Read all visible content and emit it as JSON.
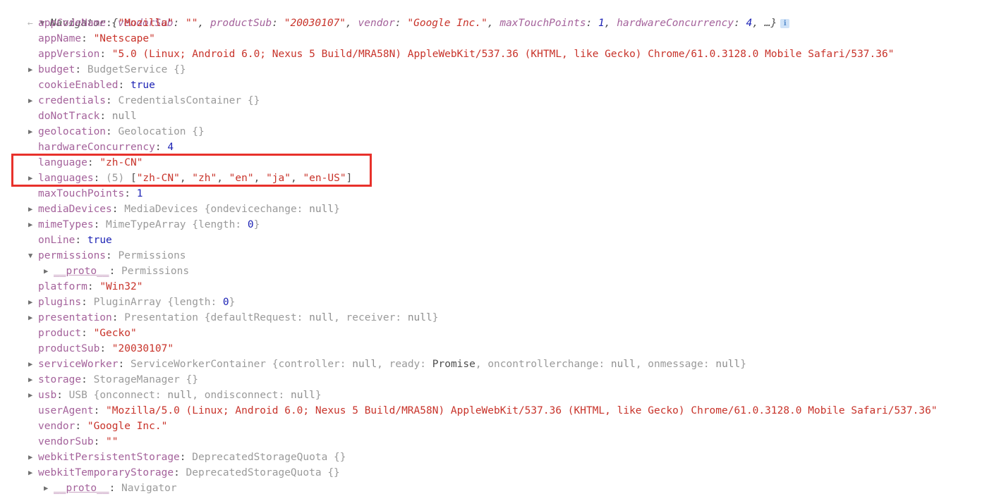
{
  "console": {
    "result_arrow": "←",
    "info_badge_label": "i",
    "header": {
      "expander": "▼",
      "class_name": "Navigator",
      "open_brace": " {",
      "preview": [
        {
          "key": "vendorSub",
          "sep": ": ",
          "value": "\"\"",
          "type": "string"
        },
        {
          "key": "productSub",
          "sep": ": ",
          "value": "\"20030107\"",
          "type": "string"
        },
        {
          "key": "vendor",
          "sep": ": ",
          "value": "\"Google Inc.\"",
          "type": "string"
        },
        {
          "key": "maxTouchPoints",
          "sep": ": ",
          "value": "1",
          "type": "number"
        },
        {
          "key": "hardwareConcurrency",
          "sep": ": ",
          "value": "4",
          "type": "number"
        }
      ],
      "ellipsis": ", …}"
    },
    "rows": [
      {
        "tri": "",
        "indent": 1,
        "prop": "appCodeName",
        "value": "\"Mozilla\"",
        "vtype": "string"
      },
      {
        "tri": "",
        "indent": 1,
        "prop": "appName",
        "value": "\"Netscape\"",
        "vtype": "string"
      },
      {
        "tri": "",
        "indent": 1,
        "prop": "appVersion",
        "value": "\"5.0 (Linux; Android 6.0; Nexus 5 Build/MRA58N) AppleWebKit/537.36 (KHTML, like Gecko) Chrome/61.0.3128.0 Mobile Safari/537.36\"",
        "vtype": "string"
      },
      {
        "tri": "▶",
        "indent": 1,
        "prop": "budget",
        "value": "BudgetService {}",
        "vtype": "class"
      },
      {
        "tri": "",
        "indent": 1,
        "prop": "cookieEnabled",
        "value": "true",
        "vtype": "bool"
      },
      {
        "tri": "▶",
        "indent": 1,
        "prop": "credentials",
        "value": "CredentialsContainer {}",
        "vtype": "class"
      },
      {
        "tri": "",
        "indent": 1,
        "prop": "doNotTrack",
        "value": "null",
        "vtype": "null"
      },
      {
        "tri": "▶",
        "indent": 1,
        "prop": "geolocation",
        "value": "Geolocation {}",
        "vtype": "class"
      },
      {
        "tri": "",
        "indent": 1,
        "prop": "hardwareConcurrency",
        "value": "4",
        "vtype": "number"
      },
      {
        "tri": "",
        "indent": 1,
        "prop": "language",
        "value": "\"zh-CN\"",
        "vtype": "string"
      },
      {
        "tri": "▶",
        "indent": 1,
        "prop": "languages",
        "value": "(5) [\"zh-CN\", \"zh\", \"en\", \"ja\", \"en-US\"]",
        "vtype": "array"
      },
      {
        "tri": "",
        "indent": 1,
        "prop": "maxTouchPoints",
        "value": "1",
        "vtype": "number"
      },
      {
        "tri": "▶",
        "indent": 1,
        "prop": "mediaDevices",
        "value": "MediaDevices {ondevicechange: null}",
        "vtype": "class"
      },
      {
        "tri": "▶",
        "indent": 1,
        "prop": "mimeTypes",
        "value": "MimeTypeArray {length: 0}",
        "vtype": "class"
      },
      {
        "tri": "",
        "indent": 1,
        "prop": "onLine",
        "value": "true",
        "vtype": "bool"
      },
      {
        "tri": "▼",
        "indent": 1,
        "prop": "permissions",
        "value": "Permissions",
        "vtype": "class"
      },
      {
        "tri": "▶",
        "indent": 2,
        "prop": "__proto__",
        "value": "Permissions",
        "vtype": "class",
        "is_proto": true
      },
      {
        "tri": "",
        "indent": 1,
        "prop": "platform",
        "value": "\"Win32\"",
        "vtype": "string"
      },
      {
        "tri": "▶",
        "indent": 1,
        "prop": "plugins",
        "value": "PluginArray {length: 0}",
        "vtype": "class"
      },
      {
        "tri": "▶",
        "indent": 1,
        "prop": "presentation",
        "value": "Presentation {defaultRequest: null, receiver: null}",
        "vtype": "class"
      },
      {
        "tri": "",
        "indent": 1,
        "prop": "product",
        "value": "\"Gecko\"",
        "vtype": "string"
      },
      {
        "tri": "",
        "indent": 1,
        "prop": "productSub",
        "value": "\"20030107\"",
        "vtype": "string"
      },
      {
        "tri": "▶",
        "indent": 1,
        "prop": "serviceWorker",
        "value": "ServiceWorkerContainer {controller: null, ready: Promise, oncontrollerchange: null, onmessage: null}",
        "vtype": "class"
      },
      {
        "tri": "▶",
        "indent": 1,
        "prop": "storage",
        "value": "StorageManager {}",
        "vtype": "class"
      },
      {
        "tri": "▶",
        "indent": 1,
        "prop": "usb",
        "value": "USB {onconnect: null, ondisconnect: null}",
        "vtype": "class"
      },
      {
        "tri": "",
        "indent": 1,
        "prop": "userAgent",
        "value": "\"Mozilla/5.0 (Linux; Android 6.0; Nexus 5 Build/MRA58N) AppleWebKit/537.36 (KHTML, like Gecko) Chrome/61.0.3128.0 Mobile Safari/537.36\"",
        "vtype": "string"
      },
      {
        "tri": "",
        "indent": 1,
        "prop": "vendor",
        "value": "\"Google Inc.\"",
        "vtype": "string"
      },
      {
        "tri": "",
        "indent": 1,
        "prop": "vendorSub",
        "value": "\"\"",
        "vtype": "string"
      },
      {
        "tri": "▶",
        "indent": 1,
        "prop": "webkitPersistentStorage",
        "value": "DeprecatedStorageQuota {}",
        "vtype": "class"
      },
      {
        "tri": "▶",
        "indent": 1,
        "prop": "webkitTemporaryStorage",
        "value": "DeprecatedStorageQuota {}",
        "vtype": "class"
      },
      {
        "tri": "▶",
        "indent": 2,
        "prop": "__proto__",
        "value": "Navigator",
        "vtype": "class",
        "is_proto": true
      }
    ]
  },
  "annotation": {
    "highlight_color": "#e8312b",
    "highlighted_rows": [
      "language",
      "languages"
    ]
  }
}
